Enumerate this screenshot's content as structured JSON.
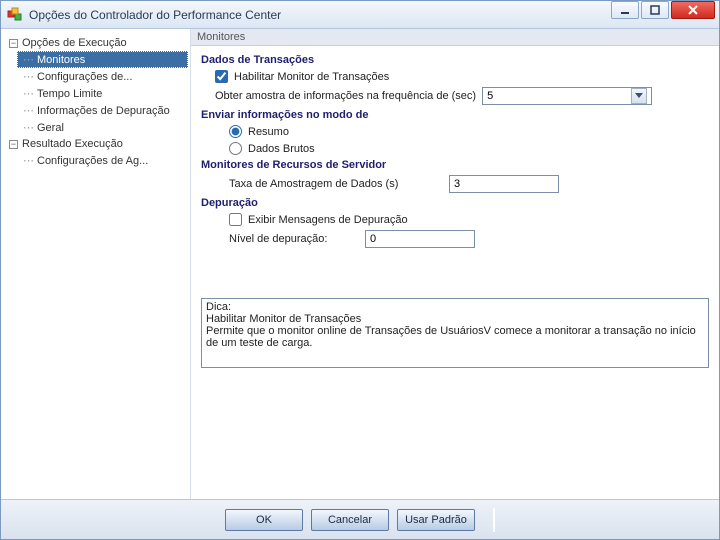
{
  "titlebar": {
    "title": "Opções do Controlador do Performance Center"
  },
  "tree": {
    "exec": {
      "label": "Opções de Execução",
      "items": [
        {
          "label": "Monitores",
          "selected": true
        },
        {
          "label": "Configurações de..."
        },
        {
          "label": "Tempo Limite"
        },
        {
          "label": "Informações de Depuração"
        },
        {
          "label": "Geral"
        }
      ]
    },
    "result": {
      "label": "Resultado Execução",
      "items": [
        {
          "label": "Configurações de Ag..."
        }
      ]
    }
  },
  "panel": {
    "header": "Monitores",
    "transactions": {
      "title": "Dados de Transações",
      "enable_label": "Habilitar Monitor de Transações",
      "enable_checked": true,
      "freq_label": "Obter amostra de informações na frequência de (sec)",
      "freq_value": "5"
    },
    "sendmode": {
      "title": "Enviar informações no modo de",
      "opt_summary": "Resumo",
      "opt_raw": "Dados Brutos",
      "selected": "summary"
    },
    "servermon": {
      "title": "Monitores de Recursos de Servidor",
      "rate_label": "Taxa de Amostragem de Dados (s)",
      "rate_value": "3"
    },
    "debug": {
      "title": "Depuração",
      "show_label": "Exibir Mensagens de Depuração",
      "show_checked": false,
      "level_label": "Nível de depuração:",
      "level_value": "0"
    },
    "hint": {
      "title": "Dica:",
      "heading": "Habilitar Monitor de Transações",
      "body": "Permite que o monitor online de Transações de UsuáriosV comece a monitorar a transação no início de um teste de carga."
    }
  },
  "buttons": {
    "ok": "OK",
    "cancel": "Cancelar",
    "default": "Usar Padrão"
  }
}
